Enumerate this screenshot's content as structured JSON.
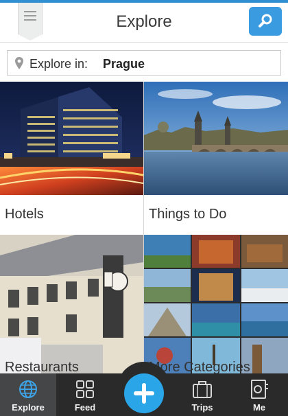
{
  "header": {
    "title": "Explore"
  },
  "location": {
    "label": "Explore in:",
    "value": "Prague"
  },
  "categories": [
    {
      "label": "Hotels"
    },
    {
      "label": "Things to Do"
    },
    {
      "label": "Restaurants"
    },
    {
      "label": "More Categories"
    }
  ],
  "tabs": [
    {
      "label": "Explore",
      "icon": "globe-icon",
      "active": true
    },
    {
      "label": "Feed",
      "icon": "grid-icon"
    },
    {
      "label": "Trips",
      "icon": "suitcase-icon"
    },
    {
      "label": "Me",
      "icon": "profile-icon"
    }
  ],
  "colors": {
    "accent": "#3b9be0",
    "fab": "#2aa6e8",
    "tabbar": "#2a2a2a",
    "active_tab": "#444647"
  }
}
